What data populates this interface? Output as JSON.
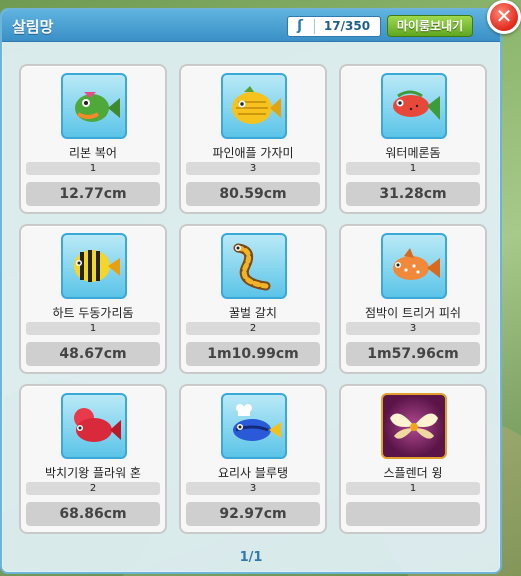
{
  "window": {
    "title": "살림망",
    "capacity": "17/350",
    "send_button": "마이룸보내기",
    "close_glyph": "✕",
    "capacity_icon": "hook-icon"
  },
  "cards": [
    {
      "name": "리본 복어",
      "count": "1",
      "size": "12.77cm",
      "icon": "ribbon-pufferfish-icon"
    },
    {
      "name": "파인애플 가자미",
      "count": "3",
      "size": "80.59cm",
      "icon": "pineapple-flounder-icon"
    },
    {
      "name": "워터메론돔",
      "count": "1",
      "size": "31.28cm",
      "icon": "watermelon-snapper-icon"
    },
    {
      "name": "하트 두동가리돔",
      "count": "1",
      "size": "48.67cm",
      "icon": "heart-butterflyfish-icon"
    },
    {
      "name": "꿀벌 갈치",
      "count": "2",
      "size": "1m10.99cm",
      "icon": "bee-hairtail-icon"
    },
    {
      "name": "점박이 트리거 피쉬",
      "count": "3",
      "size": "1m57.96cm",
      "icon": "spotted-triggerfish-icon"
    },
    {
      "name": "박치기왕 플라워 혼",
      "count": "2",
      "size": "68.86cm",
      "icon": "flowerhorn-icon"
    },
    {
      "name": "요리사 블루탱",
      "count": "3",
      "size": "92.97cm",
      "icon": "chef-bluetang-icon"
    },
    {
      "name": "스플렌더 윙",
      "count": "1",
      "size": "",
      "icon": "splendor-wing-icon"
    }
  ],
  "pager": "1/1",
  "colors": {
    "titlebar": "#3a8fc6",
    "send_button": "#5fa620",
    "close_button": "#e0281a",
    "pager": "#2f79ac"
  }
}
